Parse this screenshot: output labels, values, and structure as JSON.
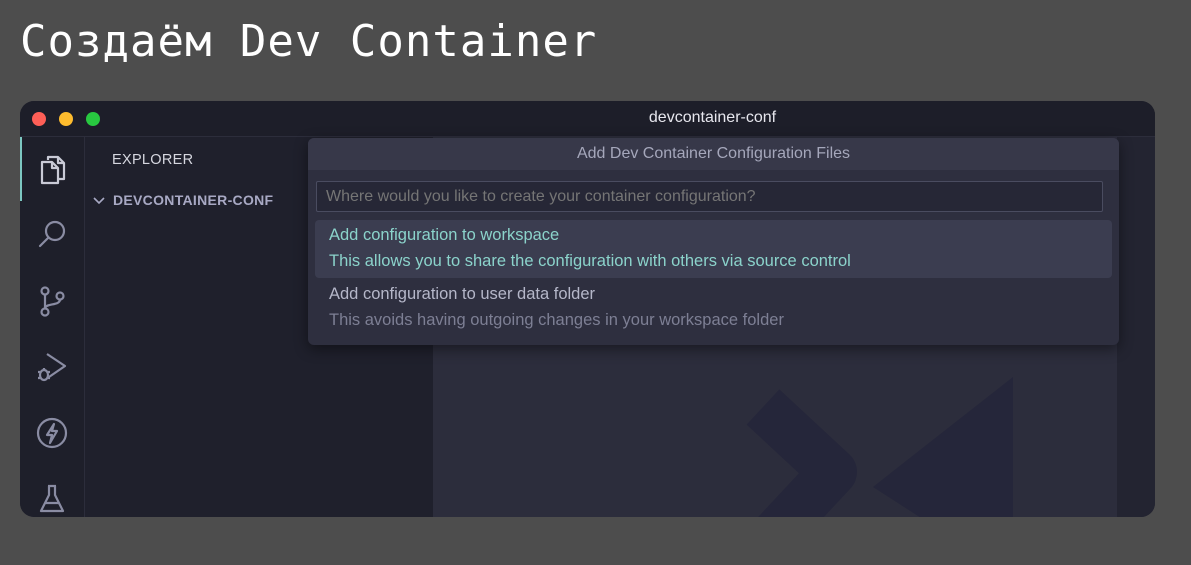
{
  "slide": {
    "title": "Создаём Dev Container"
  },
  "window": {
    "title": "devcontainer-conf"
  },
  "activity_bar": {
    "items": [
      {
        "icon": "files-icon"
      },
      {
        "icon": "search-icon"
      },
      {
        "icon": "source-control-icon"
      },
      {
        "icon": "run-debug-icon"
      },
      {
        "icon": "lightning-icon"
      },
      {
        "icon": "testing-flask-icon"
      }
    ]
  },
  "sidebar": {
    "header": "EXPLORER",
    "folder": "DEVCONTAINER-CONF"
  },
  "palette": {
    "title": "Add Dev Container Configuration Files",
    "placeholder": "Where would you like to create your container configuration?",
    "options": [
      {
        "label": "Add configuration to workspace",
        "description": "This allows you to share the configuration with others via source control"
      },
      {
        "label": "Add configuration to user data folder",
        "description": "This avoids having outgoing changes in your workspace folder"
      }
    ]
  },
  "colors": {
    "accent": "#8bd3cb",
    "background": "#4d4d4d",
    "window": "#232431"
  }
}
